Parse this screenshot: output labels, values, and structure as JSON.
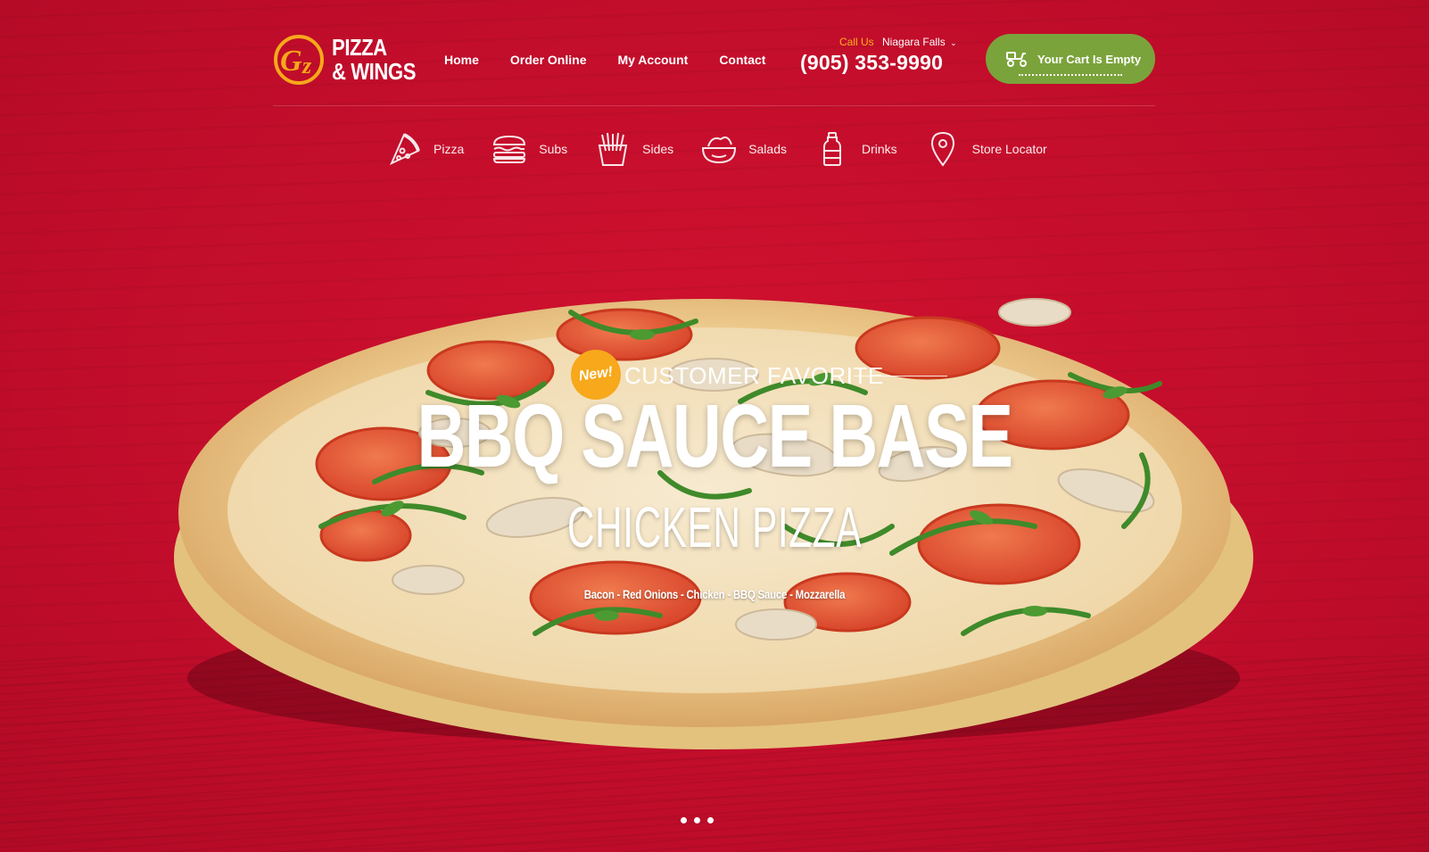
{
  "brand": {
    "logo_line1": "PIZZA",
    "logo_line2": "& WINGS",
    "logo_mark_text": "G'z",
    "colors": {
      "primary_red": "#c40f2e",
      "accent_yellow": "#f7a81b",
      "cart_green": "#7ba33b"
    }
  },
  "nav": {
    "items": [
      {
        "label": "Home"
      },
      {
        "label": "Order Online"
      },
      {
        "label": "My Account"
      },
      {
        "label": "Contact"
      }
    ]
  },
  "contact": {
    "call_us_label": "Call Us",
    "location": "Niagara Falls",
    "location_chevron_icon": "chevron-down-icon",
    "phone": "(905) 353-9990"
  },
  "cart": {
    "label": "Your Cart Is Empty",
    "icon": "scooter-icon"
  },
  "categories": [
    {
      "label": "Pizza",
      "icon": "pizza-slice-icon"
    },
    {
      "label": "Subs",
      "icon": "sub-sandwich-icon"
    },
    {
      "label": "Sides",
      "icon": "fries-icon"
    },
    {
      "label": "Salads",
      "icon": "salad-bowl-icon"
    },
    {
      "label": "Drinks",
      "icon": "bottle-icon"
    },
    {
      "label": "Store Locator",
      "icon": "map-pin-icon"
    }
  ],
  "hero": {
    "badge": "New!",
    "kicker": "CUSTOMER FAVORITE",
    "headline": "BBQ SAUCE BASE",
    "subhead": "CHICKEN PIZZA",
    "ingredients": "Bacon - Red Onions - Chicken - BBQ Sauce - Mozzarella"
  },
  "slider": {
    "slide_count": 3,
    "active_index": 0
  }
}
